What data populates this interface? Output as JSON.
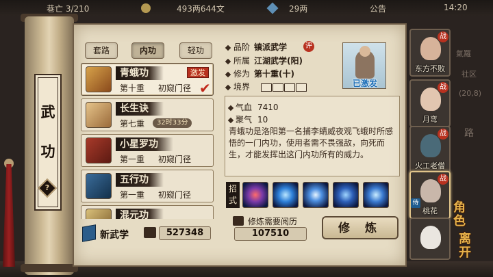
{
  "hud": {
    "left_text": "巷亡  3/210",
    "money": "493两644文",
    "gems": "29两",
    "notice": "公告",
    "clock": "14:20"
  },
  "scroll": {
    "title_1": "武",
    "title_2": "功",
    "help": "?"
  },
  "tabs": [
    {
      "label": "套路",
      "active": false
    },
    {
      "label": "内功",
      "active": true
    },
    {
      "label": "轻功",
      "active": false
    }
  ],
  "skills": [
    {
      "name": "青蛾功",
      "level": "第十重",
      "rank": "初窥门径",
      "badge": "激发",
      "selected": true
    },
    {
      "name": "长生诀",
      "level": "第七重",
      "timer": "32时33分",
      "selected": false
    },
    {
      "name": "小星罗功",
      "level": "第一重",
      "rank": "初窥门径",
      "selected": false
    },
    {
      "name": "五行功",
      "level": "第一重",
      "rank": "初窥门径",
      "selected": false
    },
    {
      "name": "混元功",
      "selected": false
    }
  ],
  "new_skill_label": "新武学",
  "read_value": "527348",
  "detail": {
    "grade_label": "品阶",
    "grade_value": "镇派武学",
    "grade_badge": "评",
    "school_label": "所属",
    "school_value": "江湖武学(阳)",
    "cultivation_label": "修为",
    "cultivation_value": "第十重(十)",
    "realm_label": "境界",
    "portrait_label": "已激发",
    "stats": [
      {
        "label": "气血",
        "value": "7410"
      },
      {
        "label": "聚气",
        "value": "10"
      }
    ],
    "description": "青蛾功是洛阳第一名捕李蜻威夜观飞蛾时所感悟的一门内功，使用者需不畏强敌，向死而生，才能发挥出这门内功所有的威力。",
    "moves_label": "招式",
    "train_cost_label": "修炼需要阅历",
    "train_cost_value": "107510",
    "train_button": "修 炼"
  },
  "roster": [
    {
      "name": "东方不败",
      "badge": "战",
      "selected": false
    },
    {
      "name": "月弯",
      "badge": "战",
      "selected": false
    },
    {
      "name": "火工老僧",
      "badge": "战",
      "selected": false
    },
    {
      "name": "桃花",
      "badge": "战",
      "selected": true
    },
    {
      "name": "",
      "badge": "",
      "selected": false
    }
  ],
  "side_menu": {
    "role": "角色",
    "leave": "离开"
  },
  "side_fragments": {
    "a": "氣羅",
    "b": "社区",
    "c": "路",
    "d": "(20,8)"
  },
  "colors": {
    "accent_red": "#b8311f",
    "paper": "#e6dcc4",
    "ink": "#2a1d12",
    "highlight_blue": "#1d6fb8"
  }
}
